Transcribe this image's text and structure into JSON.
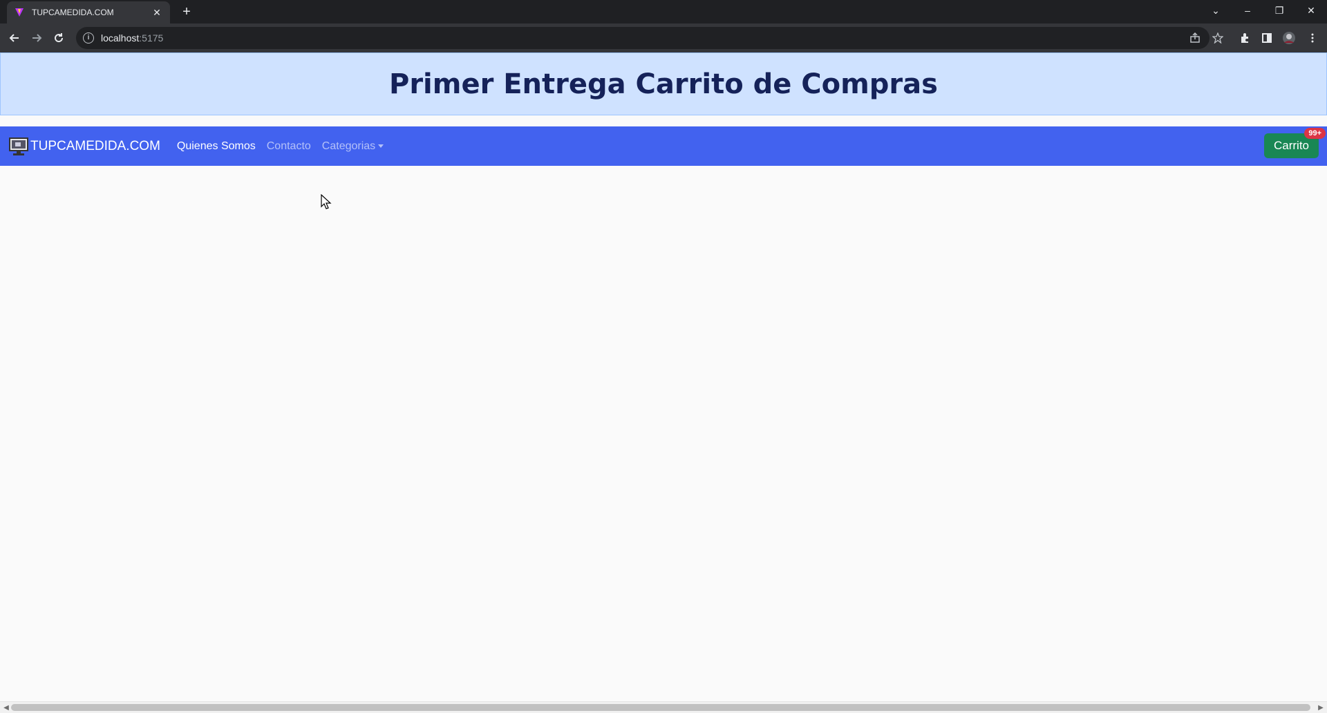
{
  "browser": {
    "tab_title": "TUPCAMEDIDA.COM",
    "tab_close": "✕",
    "new_tab": "+",
    "url_host": "localhost",
    "url_port": ":5175",
    "window_controls": {
      "dropdown": "⌄",
      "minimize": "–",
      "restore": "❐",
      "close": "✕"
    }
  },
  "hero": {
    "title": "Primer Entrega Carrito de Compras"
  },
  "navbar": {
    "brand": "TUPCAMEDIDA.COM",
    "links": [
      {
        "label": "Quienes Somos",
        "active": true
      },
      {
        "label": "Contacto",
        "active": false
      },
      {
        "label": "Categorias",
        "active": false,
        "dropdown": true
      }
    ],
    "cart_label": "Carrito",
    "cart_badge": "99+"
  },
  "colors": {
    "navbar_bg": "#4262ef",
    "hero_bg": "#cfe2ff",
    "cart_bg": "#198754",
    "badge_bg": "#dc3545"
  }
}
